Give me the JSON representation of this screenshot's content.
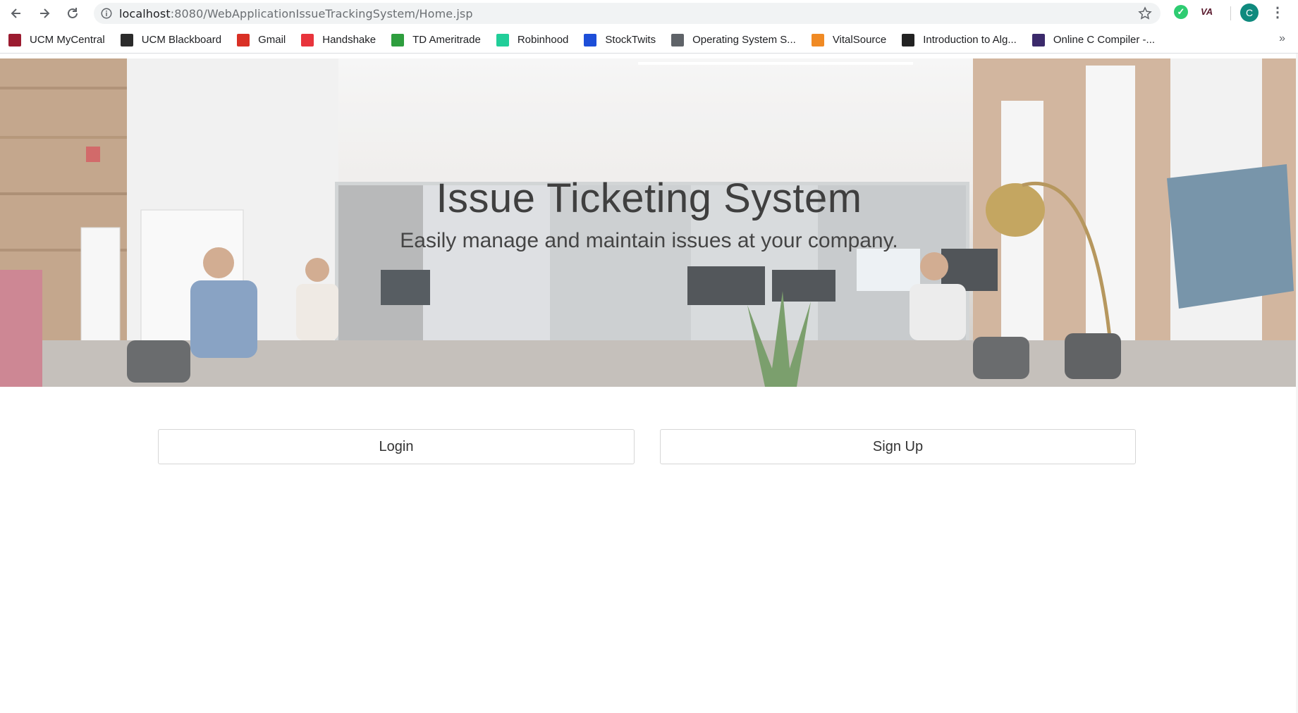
{
  "browser": {
    "url_host": "localhost",
    "url_path": ":8080/WebApplicationIssueTrackingSystem/Home.jsp",
    "profile_initial": "C",
    "extension_va": "VA",
    "more_bookmarks": "»",
    "bookmarks": [
      {
        "label": "UCM MyCentral",
        "icon": "ucm-mycentral-icon",
        "color": "#9b1b30"
      },
      {
        "label": "UCM Blackboard",
        "icon": "blackboard-icon",
        "color": "#2b2b2b"
      },
      {
        "label": "Gmail",
        "icon": "gmail-icon",
        "color": "#d93025"
      },
      {
        "label": "Handshake",
        "icon": "handshake-icon",
        "color": "#e8343c"
      },
      {
        "label": "TD Ameritrade",
        "icon": "td-ameritrade-icon",
        "color": "#2e9e3e"
      },
      {
        "label": "Robinhood",
        "icon": "robinhood-icon",
        "color": "#21ce99"
      },
      {
        "label": "StockTwits",
        "icon": "stocktwits-icon",
        "color": "#1d4ed8"
      },
      {
        "label": "Operating System S...",
        "icon": "globe-icon",
        "color": "#5f6368"
      },
      {
        "label": "VitalSource",
        "icon": "vitalsource-icon",
        "color": "#f08a24"
      },
      {
        "label": "Introduction to Alg...",
        "icon": "book-icon",
        "color": "#222222"
      },
      {
        "label": "Online C Compiler -...",
        "icon": "compiler-icon",
        "color": "#3b2a6b"
      }
    ]
  },
  "page": {
    "title": "Issue Ticketing System",
    "subtitle": "Easily manage and maintain issues at your company.",
    "login_label": "Login",
    "signup_label": "Sign Up"
  }
}
